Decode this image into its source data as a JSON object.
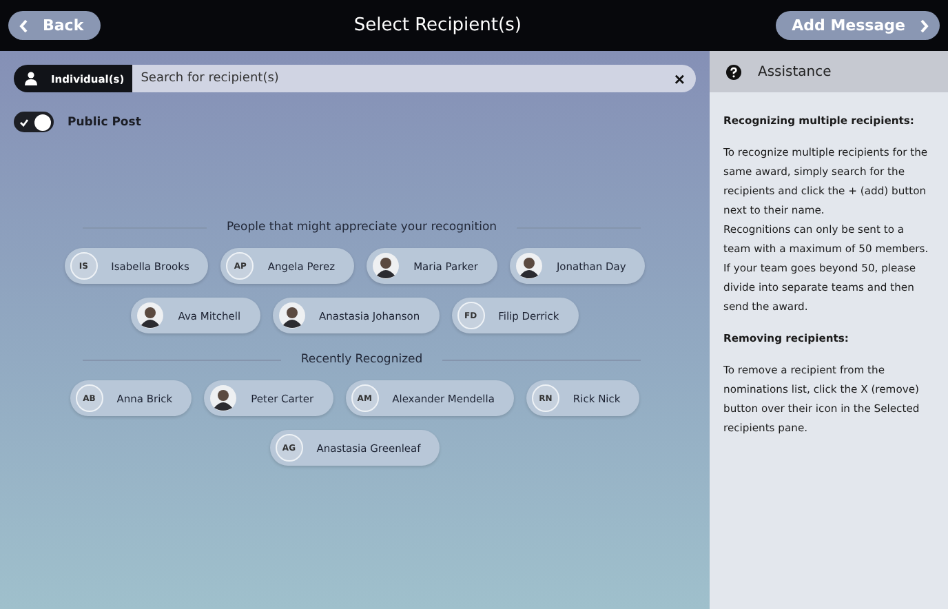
{
  "header": {
    "back": "Back",
    "title": "Select Recipient(s)",
    "next": "Add Message"
  },
  "search": {
    "mode": "Individual(s)",
    "placeholder": "Search for recipient(s)",
    "clear": "×"
  },
  "public_post": {
    "label": "Public Post",
    "on": true
  },
  "sections": [
    {
      "title": "People that might appreciate your recognition",
      "rows": [
        [
          {
            "name": "Isabella Brooks",
            "kind": "initials",
            "initials": "IS"
          },
          {
            "name": "Angela Perez",
            "kind": "initials",
            "initials": "AP"
          },
          {
            "name": "Maria Parker",
            "kind": "photo"
          },
          {
            "name": "Jonathan Day",
            "kind": "photo"
          }
        ],
        [
          {
            "name": "Ava Mitchell",
            "kind": "photo"
          },
          {
            "name": "Anastasia Johanson",
            "kind": "photo"
          },
          {
            "name": "Filip Derrick",
            "kind": "initials",
            "initials": "FD"
          }
        ]
      ]
    },
    {
      "title": "Recently Recognized",
      "rows": [
        [
          {
            "name": "Anna Brick",
            "kind": "initials",
            "initials": "AB"
          },
          {
            "name": "Peter Carter",
            "kind": "photo"
          },
          {
            "name": "Alexander Mendella",
            "kind": "initials",
            "initials": "AM"
          },
          {
            "name": "Rick Nick",
            "kind": "initials",
            "initials": "RN"
          }
        ],
        [
          {
            "name": "Anastasia Greenleaf",
            "kind": "initials",
            "initials": "AG"
          }
        ]
      ]
    }
  ],
  "assistance": {
    "title": "Assistance",
    "blocks": [
      {
        "kind": "heading",
        "text": "Recognizing multiple recipients:"
      },
      {
        "kind": "text",
        "text": "To recognize multiple recipients for the same award, simply search for the recipients and click the + (add) button next to their name."
      },
      {
        "kind": "text",
        "text": "Recognitions can only be sent to a team with a maximum of 50 members. If your team goes beyond 50, please divide into separate teams and then send the award."
      },
      {
        "kind": "heading",
        "text": "Removing recipients:"
      },
      {
        "kind": "text",
        "text": "To remove a recipient from the nominations list, click the X (remove) button over their icon in the Selected recipients pane."
      }
    ]
  }
}
